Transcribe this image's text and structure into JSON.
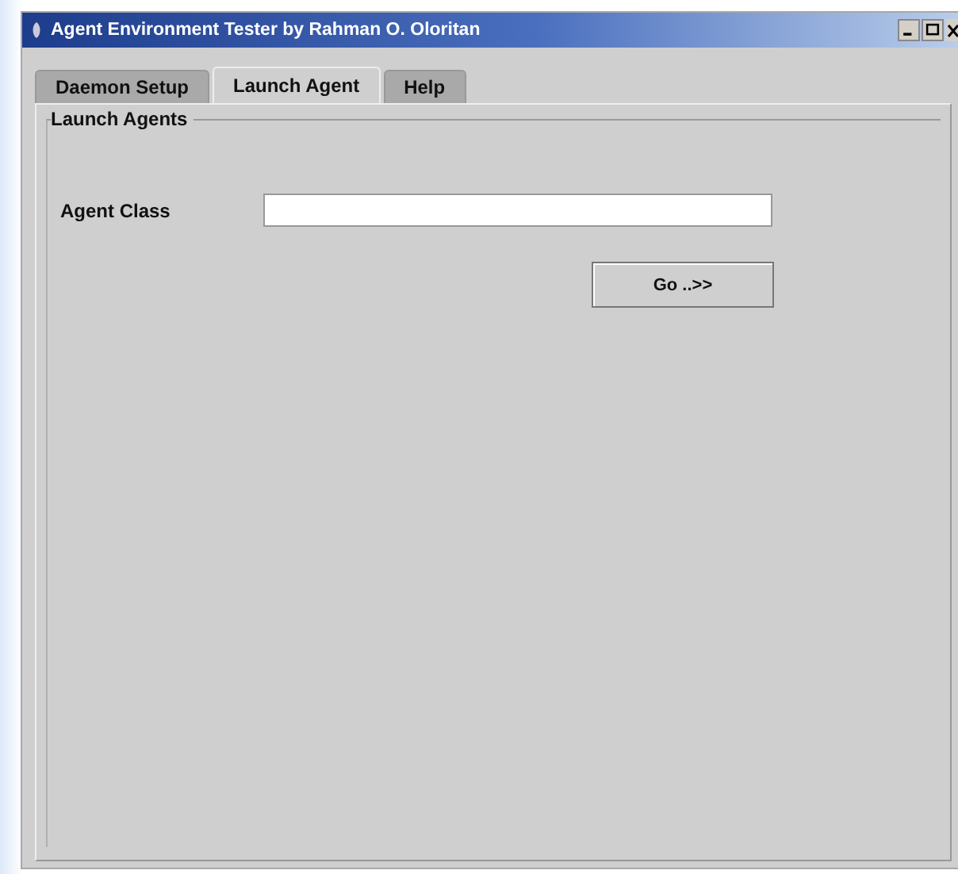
{
  "window": {
    "title": "Agent Environment Tester by Rahman O. Oloritan"
  },
  "tabs": [
    {
      "label": "Daemon Setup",
      "selected": false
    },
    {
      "label": "Launch Agent",
      "selected": true
    },
    {
      "label": "Help",
      "selected": false
    }
  ],
  "group": {
    "title": "Launch Agents"
  },
  "form": {
    "label": "Agent Class",
    "button": "Go ..>>"
  }
}
